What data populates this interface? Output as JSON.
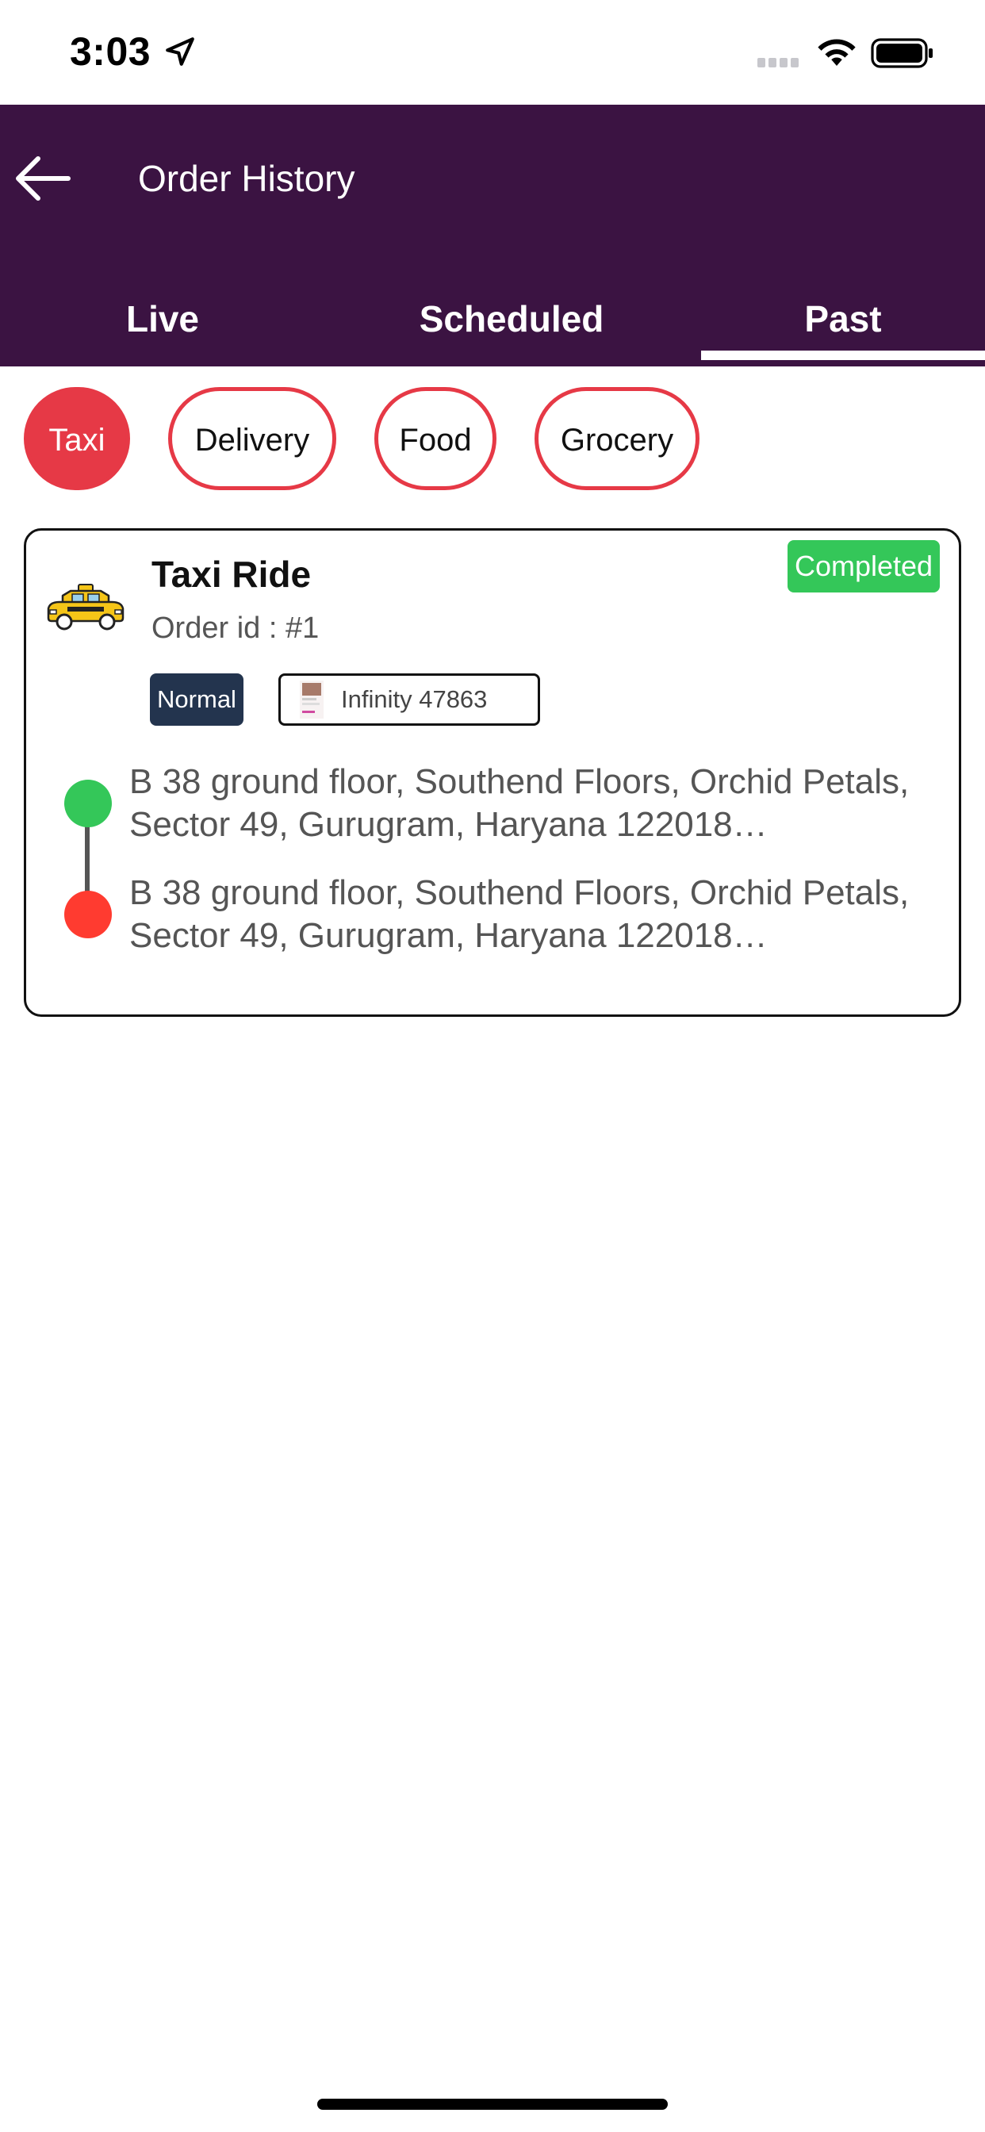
{
  "status_bar": {
    "time": "3:03"
  },
  "header": {
    "title": "Order History"
  },
  "tabs": [
    {
      "label": "Live"
    },
    {
      "label": "Scheduled"
    },
    {
      "label": "Past",
      "selected": true
    }
  ],
  "filters": [
    {
      "label": "Taxi",
      "selected": true
    },
    {
      "label": "Delivery"
    },
    {
      "label": "Food"
    },
    {
      "label": "Grocery"
    }
  ],
  "order": {
    "icon": "taxi-icon",
    "title": "Taxi Ride",
    "order_id": "Order id : #1",
    "status": "Completed",
    "ride_type": "Normal",
    "vehicle": "Infinity 47863",
    "pickup": "B 38 ground floor, Southend Floors, Orchid Petals, Sector 49, Gurugram, Haryana 122018…",
    "drop": "B 38 ground floor, Southend Floors, Orchid Petals, Sector 49, Gurugram, Haryana 122018…"
  },
  "colors": {
    "header_bg": "#3b1342",
    "accent_red": "#e63946",
    "completed_green": "#34c759",
    "drop_red": "#ff3b30",
    "ride_type_bg": "#23344e"
  }
}
